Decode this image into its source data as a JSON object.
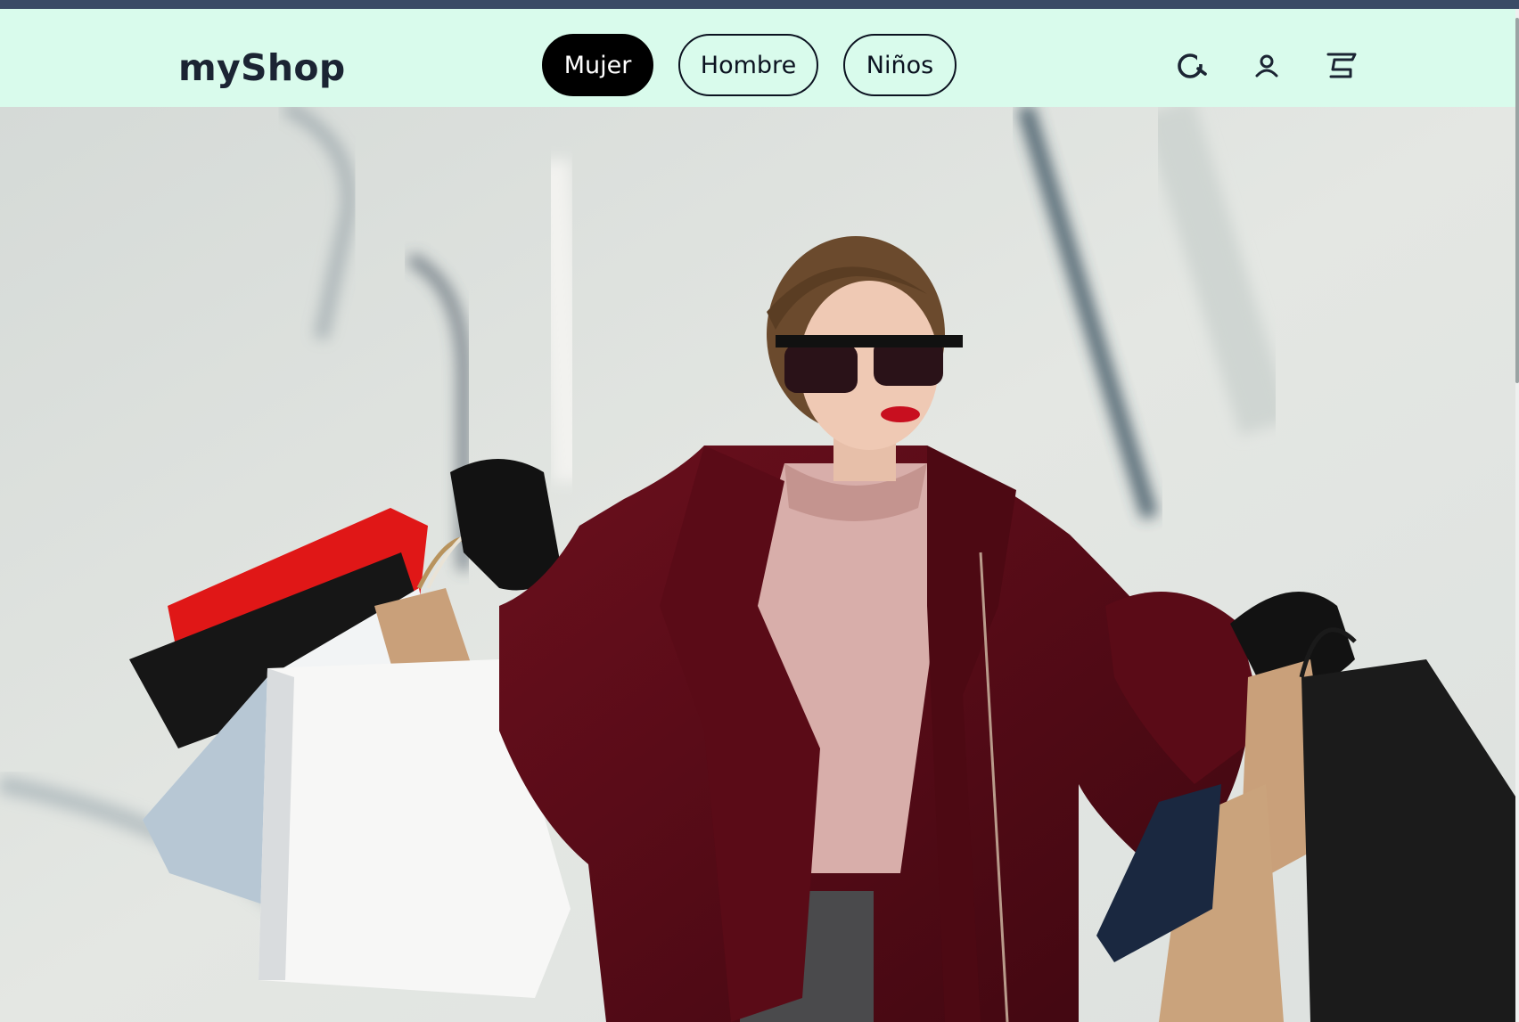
{
  "header": {
    "brand": "myShop",
    "nav": [
      {
        "label": "Mujer",
        "active": true
      },
      {
        "label": "Hombre",
        "active": false
      },
      {
        "label": "Niños",
        "active": false
      }
    ],
    "icons": [
      "search-icon",
      "user-icon",
      "cart-icon"
    ]
  },
  "colors": {
    "header_bg": "#d9fbec",
    "top_strip": "#3b4b66",
    "text_dark": "#1b2433",
    "active_pill": "#000000"
  }
}
